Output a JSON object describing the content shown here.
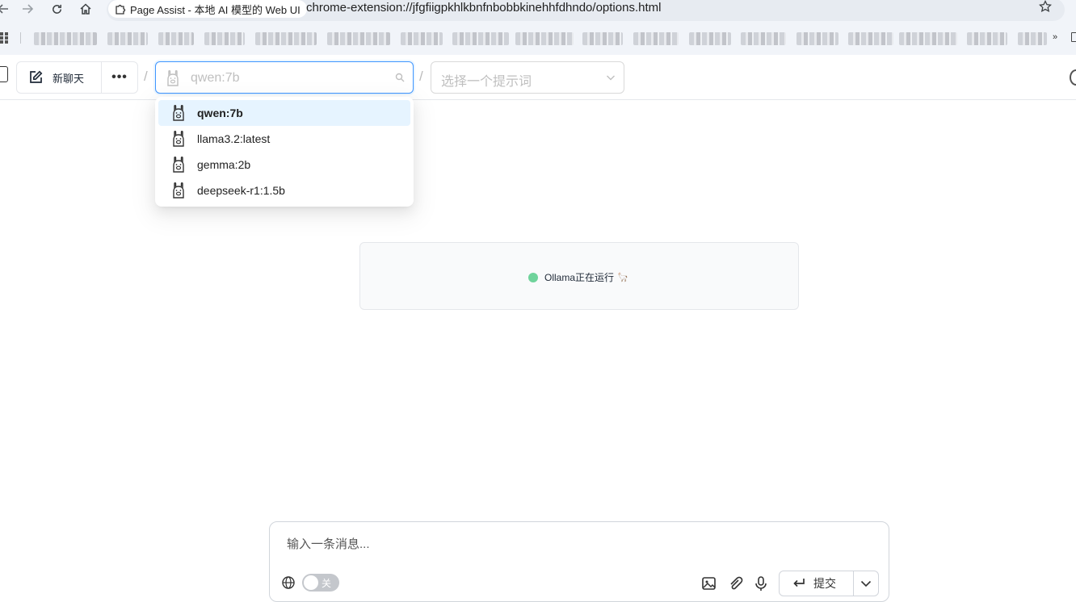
{
  "browser": {
    "tab_title": "Page Assist - 本地 AI 模型的 Web UI",
    "url": "chrome-extension://jfgfiigpkhlkbnfnbobbkinehhfdhndo/options.html",
    "back_icon": "back-arrow-icon",
    "forward_icon": "forward-arrow-icon",
    "reload_icon": "reload-icon",
    "home_icon": "home-icon",
    "bookmark_star_icon": "star-icon",
    "bookmarks_overflow_label": "»"
  },
  "header": {
    "new_chat_label": "新聊天",
    "more_label": "•••",
    "separator": "/",
    "model_search": {
      "placeholder": "qwen:7b"
    },
    "prompt_select": {
      "placeholder": "选择一个提示词"
    }
  },
  "model_dropdown": {
    "items": [
      {
        "label": "qwen:7b",
        "active": true
      },
      {
        "label": "llama3.2:latest",
        "active": false
      },
      {
        "label": "gemma:2b",
        "active": false
      },
      {
        "label": "deepseek-r1:1.5b",
        "active": false
      }
    ]
  },
  "status": {
    "text": "Ollama正在运行",
    "emoji": "🦙",
    "dot_color": "#6fd39b"
  },
  "composer": {
    "placeholder": "输入一条消息...",
    "toggle_label": "关",
    "submit_label": "提交"
  },
  "colors": {
    "accent": "#4096ff",
    "active_item_bg": "#e6f4ff"
  }
}
